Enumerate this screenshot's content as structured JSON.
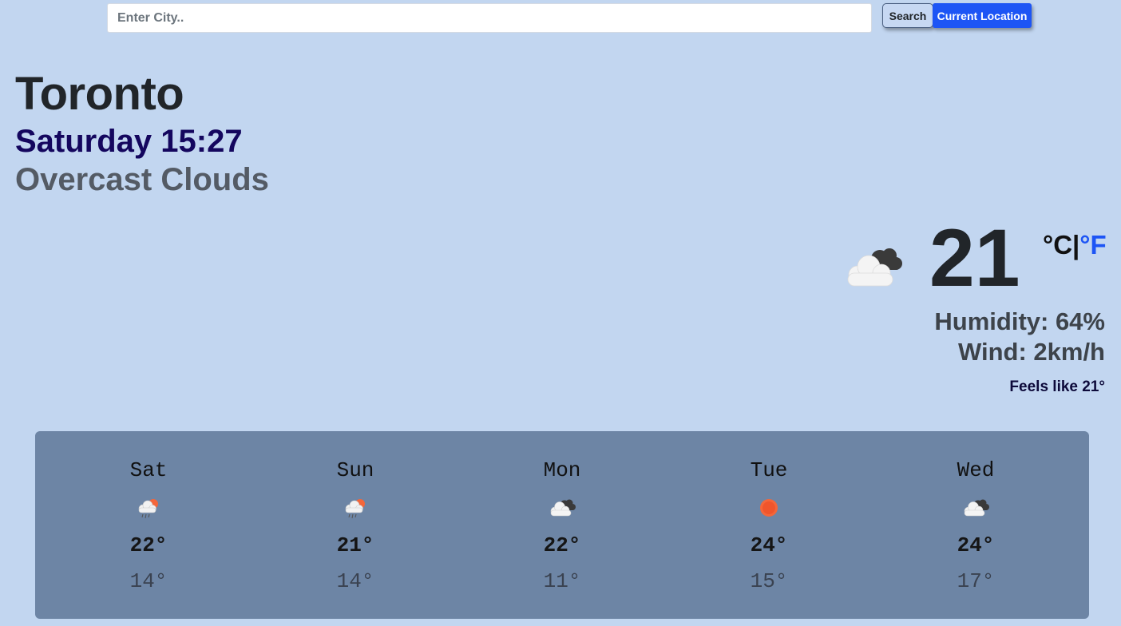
{
  "search": {
    "placeholder": "Enter City..",
    "value": "",
    "search_label": "Search",
    "location_label": "Current Location"
  },
  "location": {
    "city": "Toronto",
    "datetime": "Saturday 15:27",
    "condition": "Overcast Clouds"
  },
  "current": {
    "icon": "overcast-clouds-icon",
    "temperature": "21",
    "unit_c": "°C",
    "unit_sep": "|",
    "unit_f": "°F",
    "active_unit": "C",
    "humidity": "Humidity: 64%",
    "wind": "Wind: 2km/h",
    "feels_like": "Feels like 21°"
  },
  "colors": {
    "background": "#c2d6f0",
    "forecast_panel": "#6d85a5",
    "accent_blue": "#1d55f5",
    "datetime": "#14065e"
  },
  "forecast": [
    {
      "day": "Sat",
      "icon": "rain-sun-icon",
      "high": "22°",
      "low": "14°"
    },
    {
      "day": "Sun",
      "icon": "rain-sun-icon",
      "high": "21°",
      "low": "14°"
    },
    {
      "day": "Mon",
      "icon": "clouds-icon",
      "high": "22°",
      "low": "11°"
    },
    {
      "day": "Tue",
      "icon": "sun-icon",
      "high": "24°",
      "low": "15°"
    },
    {
      "day": "Wed",
      "icon": "clouds-icon",
      "high": "24°",
      "low": "17°"
    }
  ]
}
